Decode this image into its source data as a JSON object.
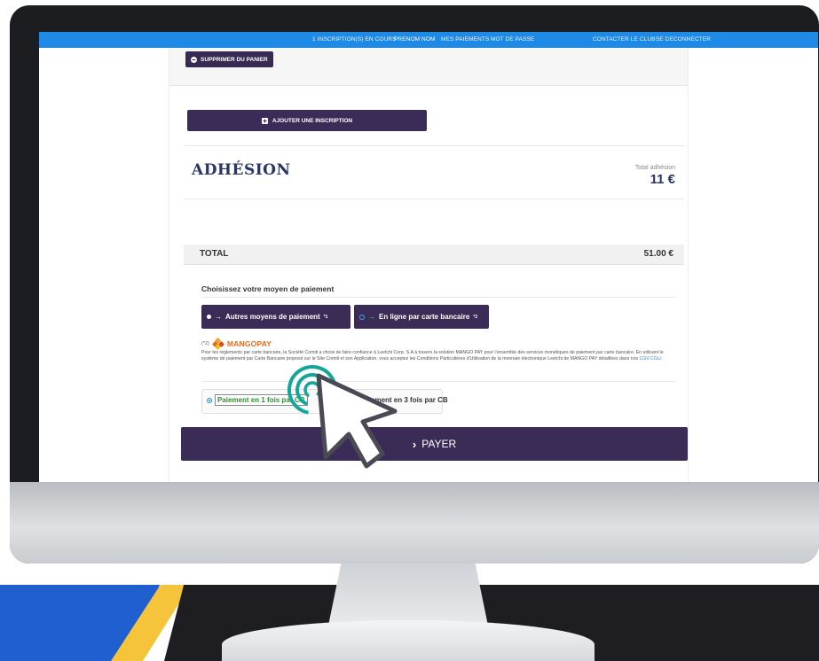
{
  "topbar": {
    "inscriptions": "1 INSCRIPTION(S) EN COURS",
    "user": "PRENOM NOM",
    "payments": "MES PAIEMENTS",
    "password": "MOT DE PASSE",
    "contact": "CONTACTER LE CLUB",
    "logout": "SE DECONNECTER"
  },
  "cart": {
    "remove_label": "SUPPRIMER DU PANIER",
    "add_label": "AJOUTER UNE INSCRIPTION"
  },
  "adhesion": {
    "title": "ADHÉSION",
    "total_label": "Total adhésion",
    "total_value": "11 €"
  },
  "total": {
    "label": "TOTAL",
    "value": "51.00 €"
  },
  "payment": {
    "heading": "Choisissez votre moyen de paiement",
    "other_methods": "Autres moyens de paiement",
    "other_methods_ref": "*1",
    "card_online": "En ligne par carte bancaire",
    "card_online_ref": "*2",
    "mangopay_note": "(*2)",
    "mangopay_brand": "MANGOPAY",
    "legal_text": "Pour les règlements par carte bancaire, la Société Comiti a choisi de faire confiance à Leetchi Corp. S.A à travers la solution MANGO PAY pour l'ensemble des services monétiques de paiement par carte bancaire. En utilisant le système de paiement par Carte Bancaire proposé sur le Site Comiti et son Application, vous acceptez les Conditions Particulières d'Utilisation de la monnaie électronique Leetchi de MANGO PAY détaillées dans nos",
    "legal_link": "CGV CGU.",
    "option_1x": "Paiement en 1 fois par CB",
    "option_3x": "Paiement en 3 fois par CB",
    "pay_label": "PAYER"
  },
  "colors": {
    "accent": "#3a2c57",
    "topbar": "#1e8ae6",
    "title": "#2a3566",
    "mangopay": "#e96b1e",
    "click_ring": "#13a79a"
  },
  "icons": {
    "remove": "minus-circle-icon",
    "add": "plus-square-icon",
    "pay": "chevron-right-icon",
    "cursor": "mouse-pointer-icon"
  }
}
